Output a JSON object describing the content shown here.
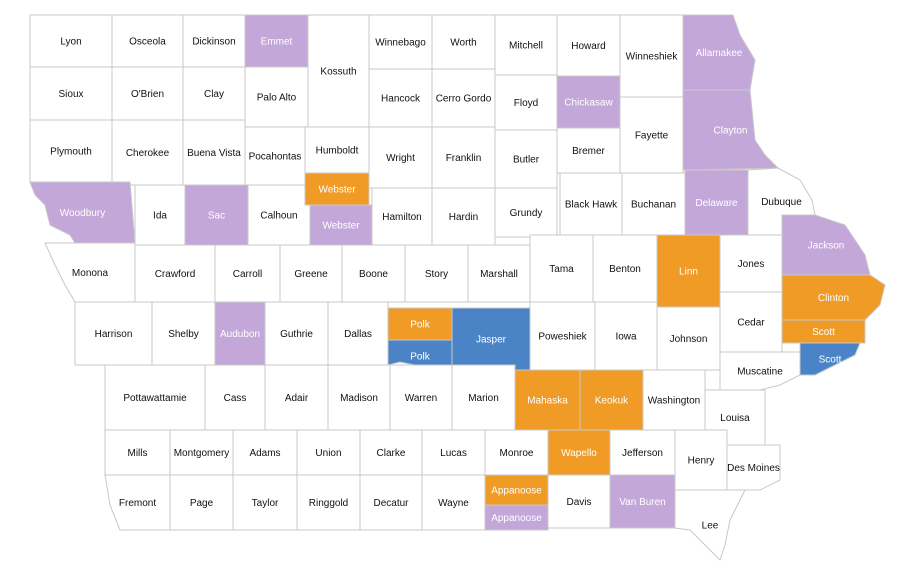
{
  "colors": {
    "orange": "#F09B26",
    "purple": "#C3A7D9",
    "blue": "#4A84C7",
    "none": "#FFFFFF",
    "border": "#C8C8C8",
    "text_dark": "#111111",
    "text_light": "#FFFFFF"
  },
  "counties": [
    {
      "name": "Lyon",
      "fill": "none"
    },
    {
      "name": "Osceola",
      "fill": "none"
    },
    {
      "name": "Dickinson",
      "fill": "none"
    },
    {
      "name": "Emmet",
      "fill": "purple"
    },
    {
      "name": "Kossuth",
      "fill": "none"
    },
    {
      "name": "Winnebago",
      "fill": "none"
    },
    {
      "name": "Worth",
      "fill": "none"
    },
    {
      "name": "Mitchell",
      "fill": "none"
    },
    {
      "name": "Howard",
      "fill": "none"
    },
    {
      "name": "Winneshiek",
      "fill": "none"
    },
    {
      "name": "Allamakee",
      "fill": "purple"
    },
    {
      "name": "Sioux",
      "fill": "none"
    },
    {
      "name": "O'Brien",
      "fill": "none"
    },
    {
      "name": "Clay",
      "fill": "none"
    },
    {
      "name": "Palo Alto",
      "fill": "none"
    },
    {
      "name": "Hancock",
      "fill": "none"
    },
    {
      "name": "Cerro Gordo",
      "fill": "none"
    },
    {
      "name": "Floyd",
      "fill": "none"
    },
    {
      "name": "Chickasaw",
      "fill": "purple"
    },
    {
      "name": "Fayette",
      "fill": "none"
    },
    {
      "name": "Clayton",
      "fill": "purple"
    },
    {
      "name": "Plymouth",
      "fill": "none"
    },
    {
      "name": "Cherokee",
      "fill": "none"
    },
    {
      "name": "Buena Vista",
      "fill": "none"
    },
    {
      "name": "Pocahontas",
      "fill": "none"
    },
    {
      "name": "Humboldt",
      "fill": "none"
    },
    {
      "name": "Wright",
      "fill": "none"
    },
    {
      "name": "Franklin",
      "fill": "none"
    },
    {
      "name": "Butler",
      "fill": "none"
    },
    {
      "name": "Bremer",
      "fill": "none"
    },
    {
      "name": "Black Hawk",
      "fill": "none"
    },
    {
      "name": "Buchanan",
      "fill": "none"
    },
    {
      "name": "Delaware",
      "fill": "purple"
    },
    {
      "name": "Dubuque",
      "fill": "none"
    },
    {
      "name": "Woodbury",
      "fill": "purple"
    },
    {
      "name": "Ida",
      "fill": "none"
    },
    {
      "name": "Sac",
      "fill": "purple"
    },
    {
      "name": "Calhoun",
      "fill": "none"
    },
    {
      "name": "Webster",
      "fill": "orange"
    },
    {
      "name": "Webster",
      "fill": "purple"
    },
    {
      "name": "Hamilton",
      "fill": "none"
    },
    {
      "name": "Hardin",
      "fill": "none"
    },
    {
      "name": "Grundy",
      "fill": "none"
    },
    {
      "name": "Monona",
      "fill": "none"
    },
    {
      "name": "Crawford",
      "fill": "none"
    },
    {
      "name": "Carroll",
      "fill": "none"
    },
    {
      "name": "Greene",
      "fill": "none"
    },
    {
      "name": "Boone",
      "fill": "none"
    },
    {
      "name": "Story",
      "fill": "none"
    },
    {
      "name": "Marshall",
      "fill": "none"
    },
    {
      "name": "Tama",
      "fill": "none"
    },
    {
      "name": "Benton",
      "fill": "none"
    },
    {
      "name": "Linn",
      "fill": "orange"
    },
    {
      "name": "Jones",
      "fill": "none"
    },
    {
      "name": "Jackson",
      "fill": "purple"
    },
    {
      "name": "Harrison",
      "fill": "none"
    },
    {
      "name": "Shelby",
      "fill": "none"
    },
    {
      "name": "Audubon",
      "fill": "purple"
    },
    {
      "name": "Guthrie",
      "fill": "none"
    },
    {
      "name": "Dallas",
      "fill": "none"
    },
    {
      "name": "Polk",
      "fill": "orange"
    },
    {
      "name": "Polk",
      "fill": "blue"
    },
    {
      "name": "Jasper",
      "fill": "blue"
    },
    {
      "name": "Poweshiek",
      "fill": "none"
    },
    {
      "name": "Iowa",
      "fill": "none"
    },
    {
      "name": "Johnson",
      "fill": "none"
    },
    {
      "name": "Cedar",
      "fill": "none"
    },
    {
      "name": "Clinton",
      "fill": "orange"
    },
    {
      "name": "Scott",
      "fill": "orange"
    },
    {
      "name": "Scott",
      "fill": "blue"
    },
    {
      "name": "Pottawattamie",
      "fill": "none"
    },
    {
      "name": "Cass",
      "fill": "none"
    },
    {
      "name": "Adair",
      "fill": "none"
    },
    {
      "name": "Madison",
      "fill": "none"
    },
    {
      "name": "Warren",
      "fill": "none"
    },
    {
      "name": "Marion",
      "fill": "none"
    },
    {
      "name": "Mahaska",
      "fill": "orange"
    },
    {
      "name": "Keokuk",
      "fill": "orange"
    },
    {
      "name": "Washington",
      "fill": "none"
    },
    {
      "name": "Muscatine",
      "fill": "none"
    },
    {
      "name": "Louisa",
      "fill": "none"
    },
    {
      "name": "Mills",
      "fill": "none"
    },
    {
      "name": "Montgomery",
      "fill": "none"
    },
    {
      "name": "Adams",
      "fill": "none"
    },
    {
      "name": "Union",
      "fill": "none"
    },
    {
      "name": "Clarke",
      "fill": "none"
    },
    {
      "name": "Lucas",
      "fill": "none"
    },
    {
      "name": "Monroe",
      "fill": "none"
    },
    {
      "name": "Wapello",
      "fill": "orange"
    },
    {
      "name": "Jefferson",
      "fill": "none"
    },
    {
      "name": "Henry",
      "fill": "none"
    },
    {
      "name": "Des Moines",
      "fill": "none"
    },
    {
      "name": "Fremont",
      "fill": "none"
    },
    {
      "name": "Page",
      "fill": "none"
    },
    {
      "name": "Taylor",
      "fill": "none"
    },
    {
      "name": "Ringgold",
      "fill": "none"
    },
    {
      "name": "Decatur",
      "fill": "none"
    },
    {
      "name": "Wayne",
      "fill": "none"
    },
    {
      "name": "Appanoose",
      "fill": "orange"
    },
    {
      "name": "Appanoose",
      "fill": "purple"
    },
    {
      "name": "Davis",
      "fill": "none"
    },
    {
      "name": "Van Buren",
      "fill": "purple"
    },
    {
      "name": "Lee",
      "fill": "none"
    }
  ]
}
